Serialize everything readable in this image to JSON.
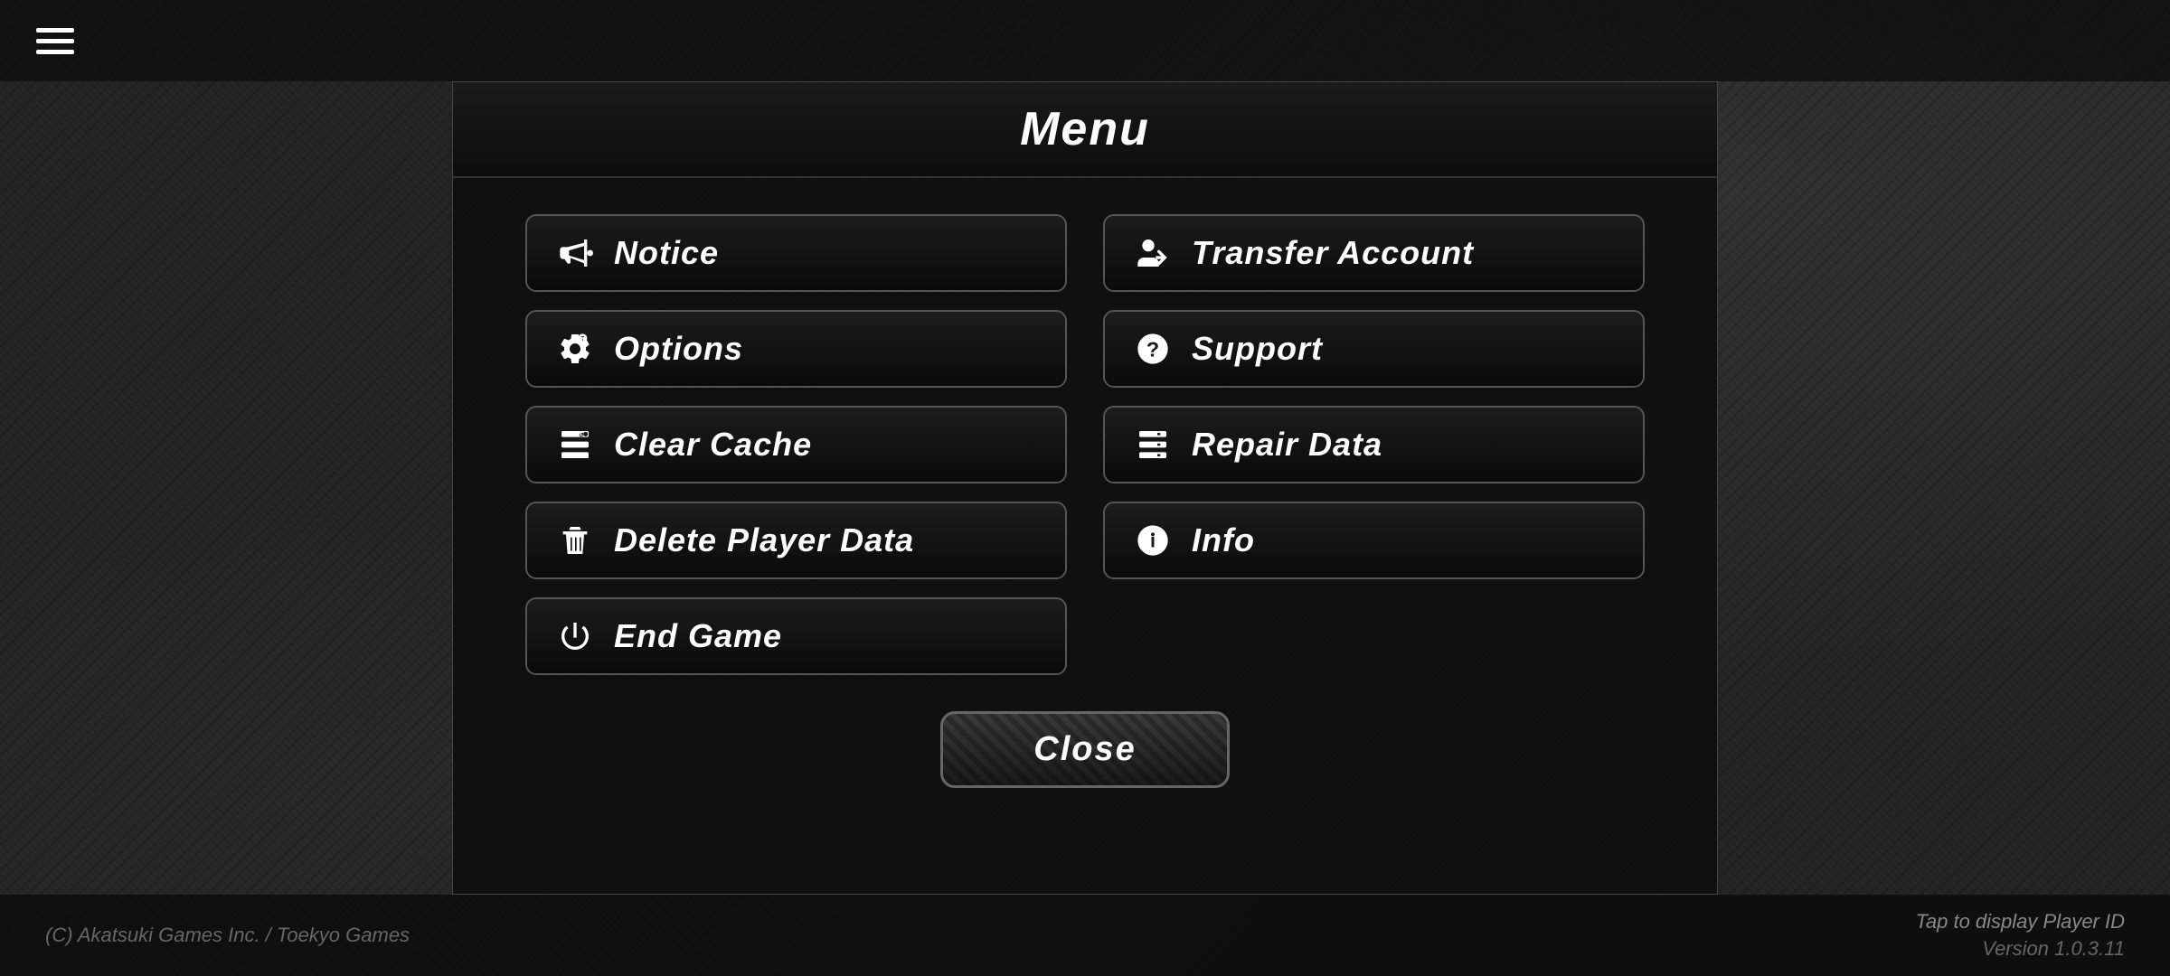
{
  "topBar": {
    "hamburgerLabel": "menu"
  },
  "dialog": {
    "title": "Menu",
    "buttons": {
      "notice": {
        "label": "Notice",
        "icon": "megaphone"
      },
      "transfer_account": {
        "label": "Transfer Account",
        "icon": "transfer"
      },
      "options": {
        "label": "Options",
        "icon": "settings"
      },
      "support": {
        "label": "Support",
        "icon": "question"
      },
      "clear_cache": {
        "label": "Clear Cache",
        "icon": "cache"
      },
      "repair_data": {
        "label": "Repair Data",
        "icon": "repair"
      },
      "delete_player_data": {
        "label": "Delete Player Data",
        "icon": "trash"
      },
      "info": {
        "label": "Info",
        "icon": "info"
      },
      "end_game": {
        "label": "End Game",
        "icon": "power"
      }
    },
    "close_label": "Close"
  },
  "bottomBar": {
    "copyright": "(C) Akatsuki Games Inc. / Toekyo Games",
    "tap_display": "Tap to display Player ID",
    "version": "Version 1.0.3.11"
  }
}
